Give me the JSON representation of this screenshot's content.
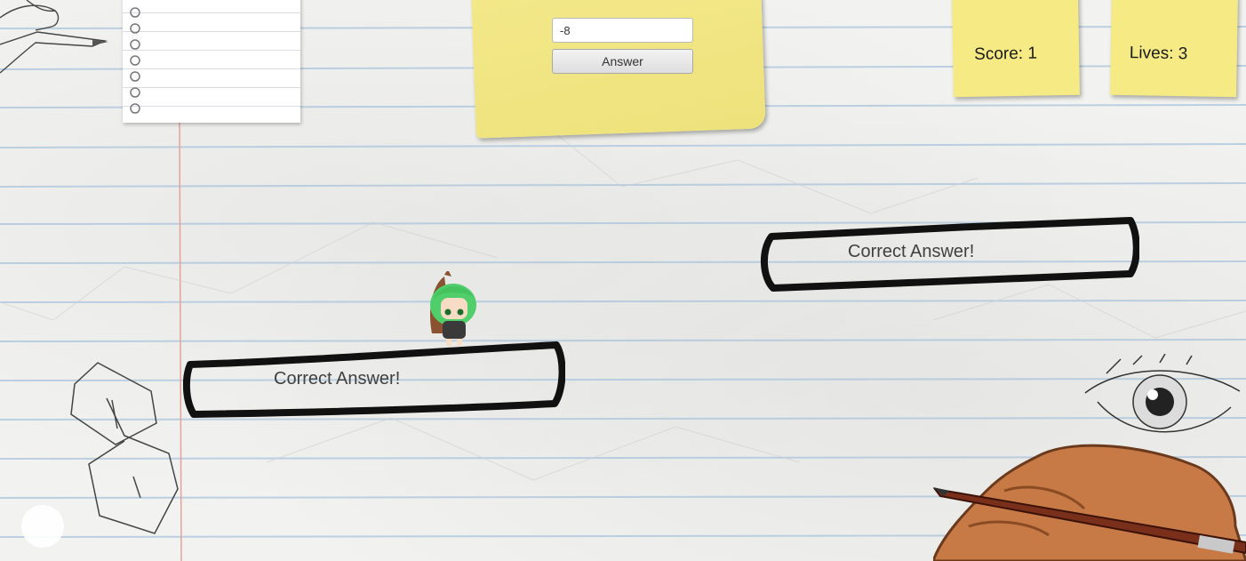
{
  "game": {
    "question_input": {
      "value": "-8"
    },
    "answer_button_label": "Answer",
    "score_label": "Score: 1",
    "lives_label": "Lives: 3",
    "platforms": [
      {
        "label": "Correct Answer!"
      },
      {
        "label": "Correct Answer!"
      }
    ]
  },
  "colors": {
    "sticky_note": "#f5ea84",
    "paper_line": "#a9c4dc",
    "margin_line": "#e4a39a",
    "ink": "#111111",
    "character_hair": "#4fce6a"
  },
  "icons": [
    "pencil-hand-icon",
    "eye-doodle-icon",
    "number-eight-doodle-icon",
    "player-character-icon"
  ]
}
